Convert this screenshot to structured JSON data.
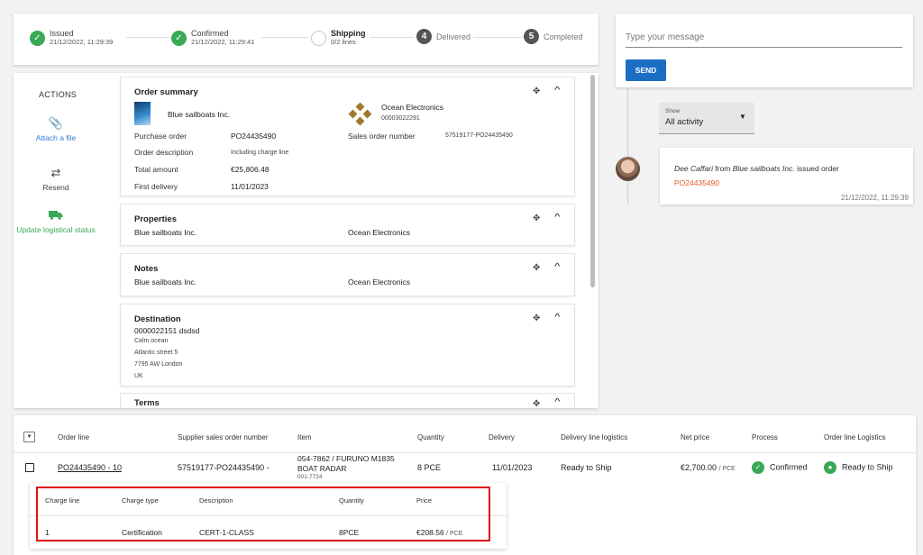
{
  "stepper": {
    "steps": [
      {
        "label": "Issued",
        "date": "21/12/2022, 11:29:39"
      },
      {
        "label": "Confirmed",
        "date": "21/12/2022, 11:29:41"
      },
      {
        "label": "Shipping",
        "date": "0/2  lines"
      },
      {
        "number": "4",
        "label": "Delivered"
      },
      {
        "number": "5",
        "label": "Completed"
      }
    ]
  },
  "actions": {
    "title": "ACTIONS",
    "items": [
      {
        "label": "Attach a file",
        "icon": "paperclip-icon",
        "color": "#2f7ed8"
      },
      {
        "label": "Resend",
        "icon": "swap-icon",
        "color": "#444444"
      },
      {
        "label": "Update logistical status",
        "icon": "truck-icon",
        "color": "#3aa955"
      }
    ]
  },
  "order_summary": {
    "title": "Order summary",
    "buyer": "Blue sailboats Inc.",
    "seller": "Ocean Electronics",
    "seller_id": "00003022291",
    "fields": [
      {
        "label": "Purchase order",
        "value": "PO24435490"
      },
      {
        "label": "Order description",
        "value": "Including charge line"
      },
      {
        "label": "Total amount",
        "value": "€25,806.48"
      },
      {
        "label": "First delivery",
        "value": "11/01/2023"
      }
    ],
    "sales_order_label": "Sales order number",
    "sales_order_value": "57519177-PO24435490"
  },
  "properties": {
    "title": "Properties",
    "left": "Blue sailboats Inc.",
    "right": "Ocean Electronics"
  },
  "notes": {
    "title": "Notes",
    "left": "Blue sailboats Inc.",
    "right": "Ocean Electronics"
  },
  "destination": {
    "title": "Destination",
    "name": "0000022151 dsdsd",
    "lines": [
      "Calm ocean",
      "Atlantic street 5",
      "7795 AW London",
      "UK"
    ]
  },
  "terms": {
    "title": "Terms"
  },
  "message": {
    "placeholder": "Type your message",
    "send_label": "SEND"
  },
  "filter": {
    "label": "Show",
    "value": "All activity"
  },
  "activity": {
    "user": "Dee Caffari",
    "from": "from",
    "company": "Blue sailboats Inc.",
    "action": "issued order",
    "order_ref": "PO24435490",
    "timestamp": "21/12/2022, 11:29:39"
  },
  "order_lines": {
    "headers": [
      "Order line",
      "Supplier sales order number",
      "Item",
      "Quantity",
      "Delivery",
      "Delivery line logistics",
      "Net price",
      "Process",
      "Order line Logistics"
    ],
    "row": {
      "order_line": "PO24435490 - 10",
      "supplier_so": "57519177-PO24435490 -",
      "item_line1": "054-7862 / FURUNO M1835",
      "item_line2": "BOAT RADAR",
      "item_line3": "001-7724",
      "quantity": "8 PCE",
      "delivery": "11/01/2023",
      "delivery_logistics": "Ready to Ship",
      "net_price": "€2,700.00",
      "net_price_unit": "/ PCE",
      "process": "Confirmed",
      "line_logistics": "Ready to Ship"
    }
  },
  "charges": {
    "headers": [
      "Charge line",
      "Charge type",
      "Description",
      "Quantity",
      "Price"
    ],
    "row": {
      "line": "1",
      "type": "Certification",
      "description": "CERT-1-CLASS",
      "quantity": "8PCE",
      "price": "€208.56",
      "price_unit": "/ PCE"
    }
  }
}
